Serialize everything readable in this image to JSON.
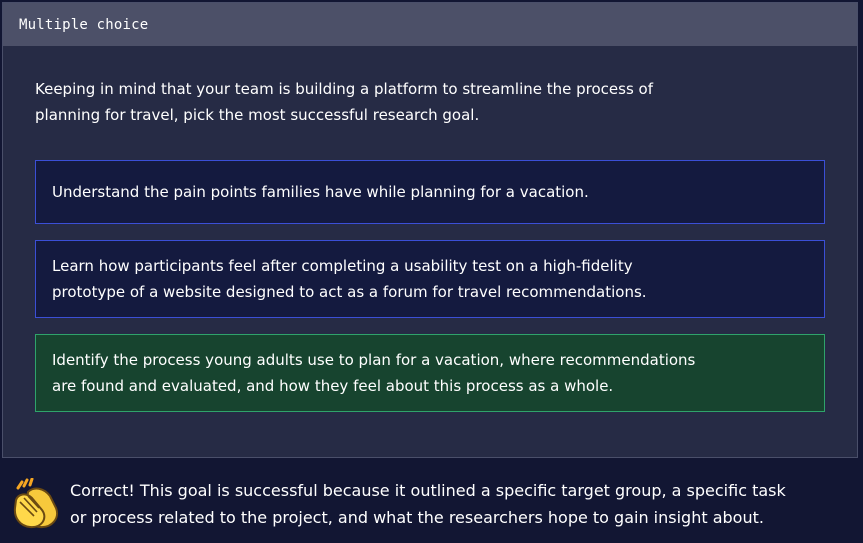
{
  "card": {
    "header": "Multiple choice",
    "question": "Keeping in mind that your team is building a platform to streamline the process of planning for travel, pick the most successful research goal.",
    "options": [
      {
        "label": "Understand the pain points families have while planning for a vacation.",
        "state": "default"
      },
      {
        "label": "Learn how participants feel after completing a usability test on a high-fidelity prototype of a website designed to act as a forum for travel recommendations.",
        "state": "default"
      },
      {
        "label": "Identify the process young adults use to plan for a vacation, where recommendations are found and evaluated, and how they feel about this process as a whole.",
        "state": "correct"
      }
    ]
  },
  "feedback": {
    "icon": "clapping-hands-icon",
    "text": "Correct! This goal is successful because it outlined a specific target group, a specific task or process related to the project, and what the researchers hope to gain insight about."
  },
  "colors": {
    "page_bg": "#121633",
    "card_bg": "#262b45",
    "header_bg": "#4c5068",
    "option_bg": "#141a3f",
    "option_border": "#3b4fd6",
    "correct_bg": "#17442f",
    "correct_border": "#2fa36b"
  }
}
